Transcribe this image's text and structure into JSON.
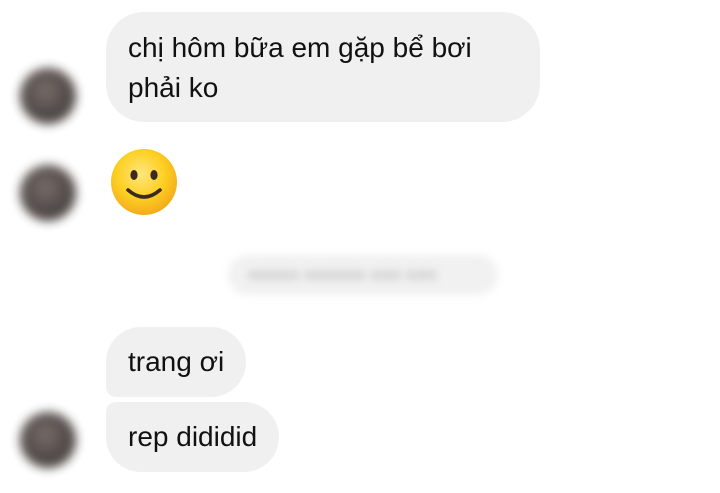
{
  "messages": [
    {
      "type": "text",
      "lines": [
        "chị hôm bữa em gặp bể bơi",
        "phải ko"
      ]
    },
    {
      "type": "emoji",
      "emoji": "slightly-smiling-face-icon"
    },
    {
      "type": "text",
      "text": "trang ơi"
    },
    {
      "type": "text",
      "text": "rep dididid"
    }
  ],
  "colors": {
    "bubble_bg": "#f0f0f0",
    "text": "#111111",
    "emoji_yellow": "#fbc02d"
  }
}
